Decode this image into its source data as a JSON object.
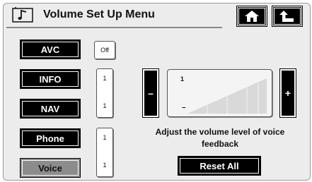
{
  "header": {
    "title": "Volume Set Up Menu",
    "icons": {
      "title": "music-note-icon",
      "home": "home-icon",
      "back": "back-arrow-icon"
    }
  },
  "sources": [
    {
      "label": "AVC"
    },
    {
      "label": "INFO"
    },
    {
      "label": "NAV"
    },
    {
      "label": "Phone"
    },
    {
      "label": "Voice",
      "selected": true
    }
  ],
  "avc_value": "Off",
  "levels": {
    "info_nav": {
      "top": "1",
      "bottom": "1"
    },
    "phone_voice": {
      "top": "1",
      "bottom": "1"
    }
  },
  "volume": {
    "minus_label": "–",
    "plus_label": "+",
    "current": "1",
    "min_marker": "–",
    "level_fraction": 0.1
  },
  "caption": "Adjust the volume level of voice feedback",
  "reset_label": "Reset All",
  "colors": {
    "button_bg": "#000000",
    "selected_bg": "#8c8c8c",
    "screen_bg": "#ececec"
  }
}
